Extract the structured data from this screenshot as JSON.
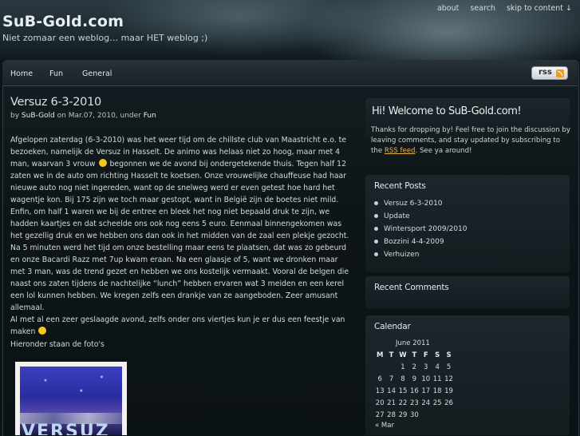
{
  "site": {
    "title": "SuB-Gold.com",
    "tagline": "Niet zomaar een weblog… maar HET weblog ;)"
  },
  "topnav": {
    "items": [
      "about",
      "search",
      "skip to content ↓"
    ]
  },
  "mainnav": {
    "items": [
      "Home",
      "Fun",
      "General"
    ],
    "rss_button": "rss"
  },
  "post": {
    "title": "Versuz 6-3-2010",
    "meta_by": "by ",
    "author": "SuB-Gold",
    "meta_on": " on Mar.07, 2010, under ",
    "category": "Fun",
    "paragraphs": [
      "Afgelopen zaterdag (6-3-2010) was het weer tijd om de chillste club van Maastricht e.o. te bezoeken, namelijk de Versuz in Hasselt. De animo was helaas niet zo hoog, maar met 4 man, waarvan 3 vrouw",
      " begonnen we de avond bij ondergetekende thuis. Tegen half 12 zaten we in de auto om richting Hasselt te koetsen. Onze vrouwelijke chauffeuse had haar nieuwe auto nog niet ingereden, want op de snelweg werd er even getest hoe hard het wagentje kon. Bij 175 zijn we toch maar gestopt, want in België zijn de boetes niet mild.",
      "Enfin, om half 1 waren we bij de entree en bleek het nog niet bepaald druk te zijn, we hadden kaartjes en dat scheelde ons ook nog eens 5 euro. Eenmaal binnengekomen was het gezellig druk en we hebben ons dan ook in het midden van de zaal een plekje gezocht. Na 5 minuten werd het tijd om onze bestelling maar eens te plaatsen, dat was zo gebeurd en onze Bacardi Razz met 7up kwam eraan. Na een glaasje of 5, want we dronken maar met 3 man, was de trend gezet en hebben we ons kostelijk vermaakt. Vooral de belgen die naast ons zaten tijdens de nachtelijke “lunch” hebben ervaren wat 3 meiden en een kerel een lol kunnen hebben. We kregen zelfs een drankje van ze aangeboden. Zeer amusant allemaal.",
      "Al met al een zeer geslaagde avond, zelfs onder ons viertjes kun je er dus een feestje van maken"
    ],
    "photos_label": "Hieronder staan de foto's",
    "photo_text": "VERSUZ"
  },
  "sidebar": {
    "welcome_title": "Hi! Welcome to SuB-Gold.com!",
    "welcome_text_before": "Thanks for dropping by! Feel free to join the discussion by leaving comments, and stay updated by subscribing to the ",
    "welcome_link": "RSS feed",
    "welcome_text_after": ". See ya around!",
    "recent_posts_title": "Recent Posts",
    "recent_posts": [
      "Versuz 6-3-2010",
      "Update",
      "Wintersport 2009/2010",
      "Bozzini 4-4-2009",
      "Verhuizen"
    ],
    "recent_comments_title": "Recent Comments",
    "calendar_title": "Calendar",
    "calendar": {
      "month": "June 2011",
      "days": [
        "M",
        "T",
        "W",
        "T",
        "F",
        "S",
        "S"
      ],
      "weeks": [
        [
          "",
          "",
          "1",
          "2",
          "3",
          "4",
          "5"
        ],
        [
          "6",
          "7",
          "8",
          "9",
          "10",
          "11",
          "12"
        ],
        [
          "13",
          "14",
          "15",
          "16",
          "17",
          "18",
          "19"
        ],
        [
          "20",
          "21",
          "22",
          "23",
          "24",
          "25",
          "26"
        ],
        [
          "27",
          "28",
          "29",
          "30",
          "",
          "",
          ""
        ]
      ],
      "prev": "« Mar"
    }
  },
  "colors": {
    "link_accent": "#e8b64a",
    "rss_orange": "#f29a1b",
    "background": "#0b1418"
  }
}
